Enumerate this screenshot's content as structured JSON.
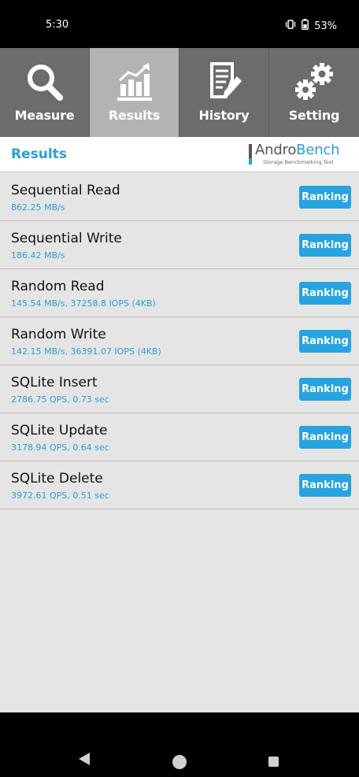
{
  "status": {
    "time": "5:30",
    "battery": "53%",
    "icons": [
      "vibrate-icon",
      "battery-icon"
    ]
  },
  "tabs": [
    {
      "label": "Measure",
      "icon": "magnifier-icon",
      "active": false
    },
    {
      "label": "Results",
      "icon": "chart-icon",
      "active": true
    },
    {
      "label": "History",
      "icon": "document-edit-icon",
      "active": false
    },
    {
      "label": "Setting",
      "icon": "gears-icon",
      "active": false
    }
  ],
  "header": {
    "title": "Results",
    "logo_andro": "Andro",
    "logo_bench": "Bench",
    "logo_sub": "Storage Benchmarking Tool"
  },
  "results": [
    {
      "name": "Sequential Read",
      "value": "862.25 MB/s",
      "button": "Ranking"
    },
    {
      "name": "Sequential Write",
      "value": "186.42 MB/s",
      "button": "Ranking"
    },
    {
      "name": "Random Read",
      "value": "145.54 MB/s, 37258.8 IOPS (4KB)",
      "button": "Ranking"
    },
    {
      "name": "Random Write",
      "value": "142.15 MB/s, 36391.07 IOPS (4KB)",
      "button": "Ranking"
    },
    {
      "name": "SQLite Insert",
      "value": "2786.75 QPS, 0.73 sec",
      "button": "Ranking"
    },
    {
      "name": "SQLite Update",
      "value": "3178.94 QPS, 0.64 sec",
      "button": "Ranking"
    },
    {
      "name": "SQLite Delete",
      "value": "3972.61 QPS, 0.51 sec",
      "button": "Ranking"
    }
  ],
  "colors": {
    "accent": "#2a9ed8",
    "tab_bg": "#6c6c6c",
    "tab_active_bg": "#b3b3b3",
    "list_bg": "#e5e5e5"
  }
}
